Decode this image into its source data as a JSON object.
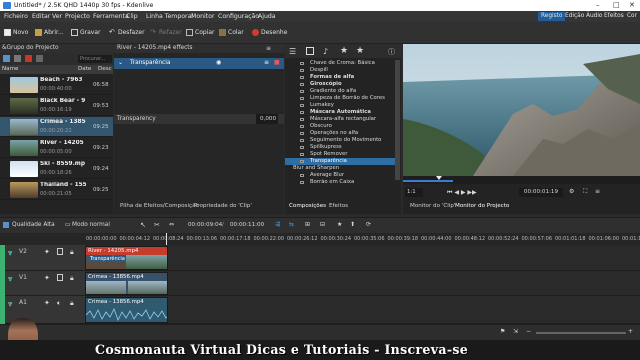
{
  "window": {
    "title": "Untitled* / 2.5K QHD 1440p 30 fps - Kdenlive"
  },
  "menubar": {
    "items": [
      "Ficheiro",
      "Editar",
      "Ver",
      "Projecto",
      "Ferramenta",
      "Clip",
      "Linha Temporal",
      "Monitor",
      "Configuração",
      "Ajuda"
    ],
    "workspaces": [
      "Registo",
      "Edição",
      "Áudio",
      "Efeitos",
      "Cor"
    ],
    "active_workspace": "Registo"
  },
  "toolbar": {
    "new": "Novo",
    "open": "Abrir...",
    "save": "Gravar",
    "undo": "Desfazer",
    "redo": "Refazer",
    "copy": "Copiar",
    "paste": "Colar",
    "render": "Desenhe"
  },
  "bin": {
    "title": "&Grupo do Projecto",
    "search_placeholder": "Procurar...",
    "col_name": "Name",
    "col_date": "Date",
    "col_desc": "Desc",
    "clips": [
      {
        "name": "Beach - 7963",
        "duration": "00:00:40:00",
        "date": "06:58"
      },
      {
        "name": "Black Bear - 9",
        "duration": "00:00:16:19",
        "date": "09:53"
      },
      {
        "name": "Crimea - 13856",
        "duration": "00:00:20:22",
        "date": "09:25"
      },
      {
        "name": "River - 14205",
        "duration": "00:00:05:00",
        "date": "09:23"
      },
      {
        "name": "Ski - 8559.mp",
        "duration": "00:00:18:26",
        "date": "09:24"
      },
      {
        "name": "Thailand - 155",
        "duration": "00:00:21:05",
        "date": "09:25"
      }
    ]
  },
  "effect_stack": {
    "clip_title": "River - 14205.mp4 effects",
    "effect_name": "Transparência",
    "param_label": "Transparency",
    "param_value": "0,000"
  },
  "effects": {
    "items": [
      {
        "label": "Chave de Croma: Básica",
        "bold": false
      },
      {
        "label": "Despill",
        "bold": false
      },
      {
        "label": "Formas de alfa",
        "bold": true
      },
      {
        "label": "Giroscópio",
        "bold": true
      },
      {
        "label": "Gradiente do alfa",
        "bold": false
      },
      {
        "label": "Limpeza de Borrão de Cores",
        "bold": false
      },
      {
        "label": "Lumakey",
        "bold": false
      },
      {
        "label": "Máscara Automática",
        "bold": true
      },
      {
        "label": "Máscara-alfa rectangular",
        "bold": false
      },
      {
        "label": "Obscuro",
        "bold": false
      },
      {
        "label": "Operações no alfa",
        "bold": false
      },
      {
        "label": "Seguimento do Movimento",
        "bold": false
      },
      {
        "label": "Spillkupress",
        "bold": false
      },
      {
        "label": "Spot Remover",
        "bold": false
      },
      {
        "label": "Transparência",
        "bold": false,
        "selected": true
      }
    ],
    "category": "Blur and Sharpen",
    "category_items": [
      "Average Blur",
      "Borrão em Caixa"
    ]
  },
  "monitor": {
    "zoom": "1:1",
    "timecode": "00:00:01:19"
  },
  "dock_tabs": {
    "left": [
      "Pilha de Efeitos/Composição",
      "Propriedade do 'Clip'"
    ],
    "middle": [
      "Composições",
      "Efeitos"
    ],
    "right": [
      "Monitor do 'Clip'",
      "Monitor do Projecto"
    ]
  },
  "timeline": {
    "quality": "Qualidade Alta",
    "mode": "Modo normal",
    "position": "00:00:09:04",
    "duration": "00:00:11:00",
    "ruler": [
      "00:00:00:00",
      "00:00:04:12",
      "00:00:08:24",
      "00:00:13:06",
      "00:00:17:18",
      "00:00:22:00",
      "00:00:26:12",
      "00:00:30:24",
      "00:00:35:06",
      "00:00:39:18",
      "00:00:44:00",
      "00:00:48:12",
      "00:00:52:24",
      "00:00:57:06",
      "00:01:01:18",
      "00:01:06:00",
      "00:01:10"
    ],
    "tracks": [
      {
        "label": "V2",
        "clips": [
          {
            "name": "River - 14205.mp4",
            "sub": "Transparência"
          }
        ]
      },
      {
        "label": "V1",
        "clips": [
          {
            "name": "Crimea - 13856.mp4"
          }
        ]
      },
      {
        "label": "A1",
        "clips": [
          {
            "name": "Crimea - 13856.mp4"
          }
        ]
      }
    ]
  },
  "banner": {
    "text": "Cosmonauta Virtual Dicas e Tutoriais - Inscreva-se"
  },
  "colors": {
    "accent": "#1f5e99",
    "selection": "#2f6ea3",
    "track_green": "#3cb371"
  }
}
